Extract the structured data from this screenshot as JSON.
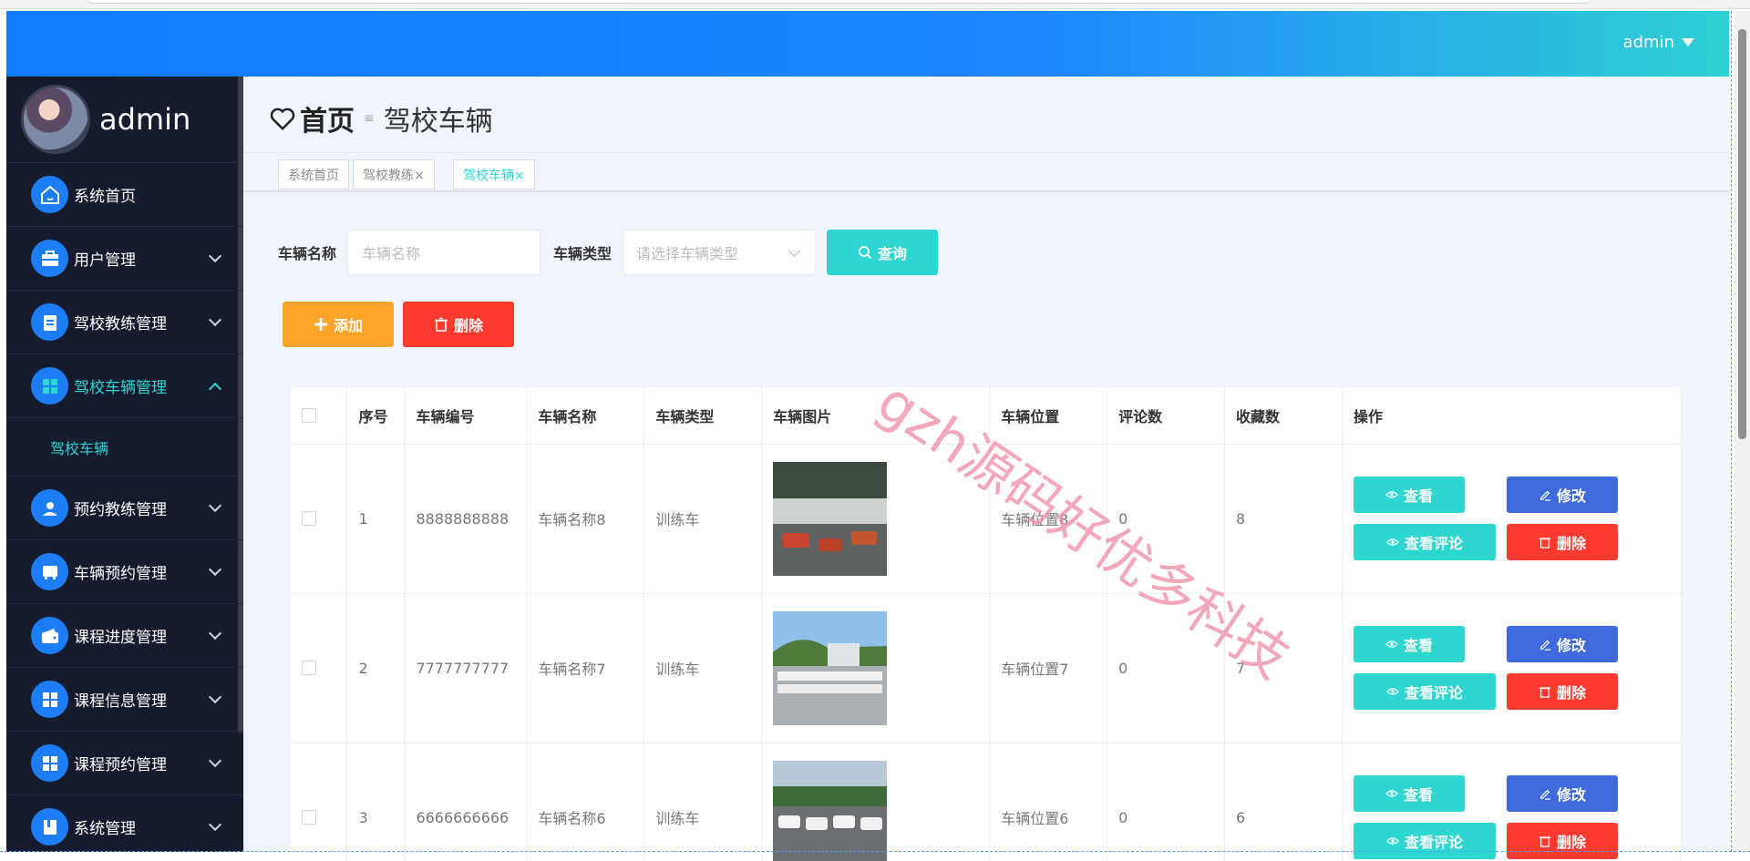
{
  "header": {
    "username": "admin"
  },
  "sidebar": {
    "profile_name": "admin",
    "items": [
      {
        "label": "系统首页",
        "icon": "home-icon"
      },
      {
        "label": "用户管理",
        "icon": "briefcase-icon"
      },
      {
        "label": "驾校教练管理",
        "icon": "clipboard-icon"
      },
      {
        "label": "驾校车辆管理",
        "icon": "grid-icon"
      },
      {
        "label": "预约教练管理",
        "icon": "user-icon"
      },
      {
        "label": "车辆预约管理",
        "icon": "bus-icon"
      },
      {
        "label": "课程进度管理",
        "icon": "wallet-icon"
      },
      {
        "label": "课程信息管理",
        "icon": "grid-icon"
      },
      {
        "label": "课程预约管理",
        "icon": "grid-icon"
      },
      {
        "label": "系统管理",
        "icon": "book-icon"
      }
    ],
    "sub_item": "驾校车辆"
  },
  "breadcrumb": {
    "home": "首页",
    "current": "驾校车辆"
  },
  "tags": [
    {
      "label": "系统首页"
    },
    {
      "label": "驾校教练×"
    },
    {
      "label": "驾校车辆×"
    }
  ],
  "search": {
    "name_label": "车辆名称",
    "name_placeholder": "车辆名称",
    "type_label": "车辆类型",
    "type_placeholder": "请选择车辆类型",
    "query_label": "查询"
  },
  "actions": {
    "add_label": "添加",
    "delete_label": "删除"
  },
  "table": {
    "headers": [
      "序号",
      "车辆编号",
      "车辆名称",
      "车辆类型",
      "车辆图片",
      "车辆位置",
      "评论数",
      "收藏数",
      "操作"
    ],
    "rows": [
      {
        "idx": "1",
        "code": "8888888888",
        "name": "车辆名称8",
        "type": "训练车",
        "location": "车辆位置8",
        "comments": "0",
        "favs": "8"
      },
      {
        "idx": "2",
        "code": "7777777777",
        "name": "车辆名称7",
        "type": "训练车",
        "location": "车辆位置7",
        "comments": "0",
        "favs": "7"
      },
      {
        "idx": "3",
        "code": "6666666666",
        "name": "车辆名称6",
        "type": "训练车",
        "location": "车辆位置6",
        "comments": "0",
        "favs": "6"
      }
    ],
    "op_view": "查看",
    "op_edit": "修改",
    "op_comment": "查看评论",
    "op_delete": "删除"
  },
  "watermark": "gzh源码好优多科技",
  "colors": {
    "primary": "#1d7df5",
    "accent": "#2dd6d0",
    "warning": "#fba42a",
    "danger": "#ff3a2f",
    "edit": "#3f6ade",
    "sidebar_bg": "#161c2e"
  }
}
